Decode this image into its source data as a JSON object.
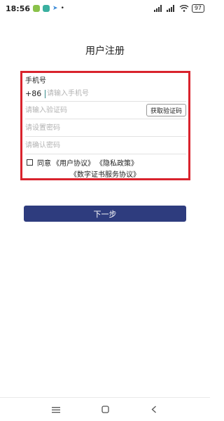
{
  "status_bar": {
    "time": "18:56",
    "battery": "97",
    "app_icon_colors": [
      "#8ac24a",
      "#3ab0a0",
      "#3b8ad8"
    ]
  },
  "page": {
    "title": "用户注册"
  },
  "form": {
    "phone_label": "手机号",
    "phone_prefix": "+86",
    "phone_placeholder": "请输入手机号",
    "code_placeholder": "请输入验证码",
    "get_code_label": "获取验证码",
    "password_placeholder": "请设置密码",
    "confirm_placeholder": "请确认密码",
    "agree_prefix": "同意",
    "user_agreement": "《用户协议》",
    "privacy_policy": "《隐私政策》",
    "cert_agreement": "《数字证书服务协议》"
  },
  "next_button": {
    "label": "下一步"
  },
  "colors": {
    "highlight_border": "#d9232d",
    "primary_button": "#2e3c7e"
  },
  "nav": {
    "menu_icon": "menu-icon",
    "home_icon": "home-icon",
    "back_icon": "back-icon"
  }
}
